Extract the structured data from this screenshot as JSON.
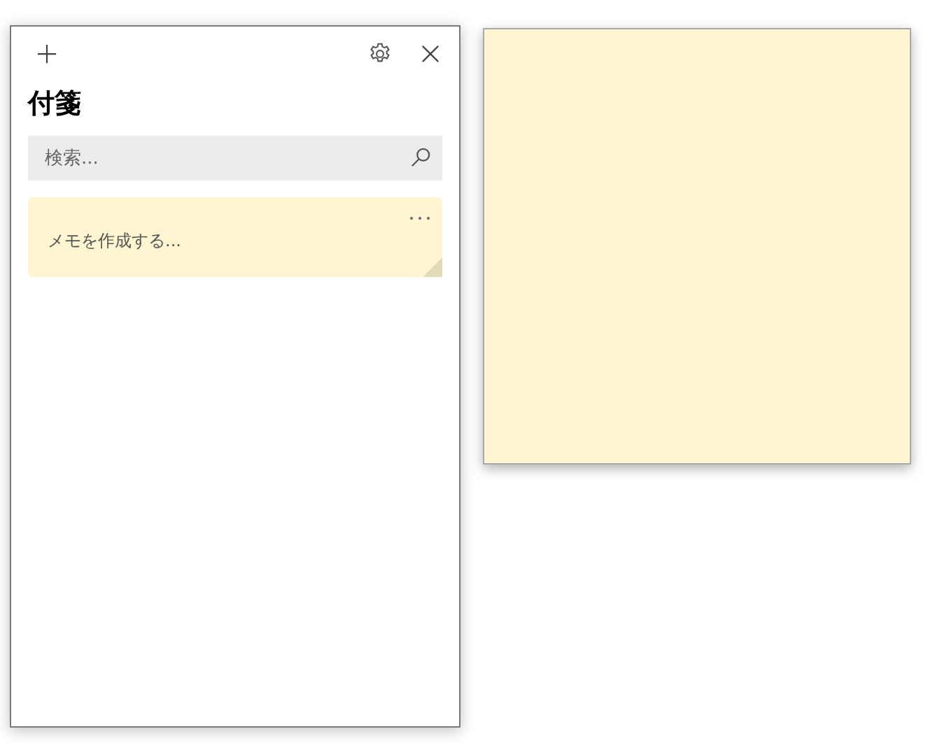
{
  "list_window": {
    "title": "付箋",
    "search": {
      "placeholder": "検索..."
    },
    "notes": [
      {
        "text": "メモを作成する..."
      }
    ]
  }
}
